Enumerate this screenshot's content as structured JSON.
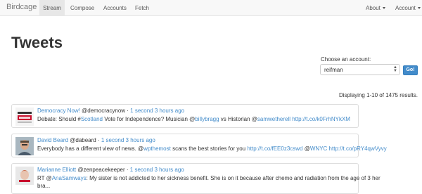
{
  "navbar": {
    "brand": "Birdcage",
    "items": [
      "Stream",
      "Compose",
      "Accounts",
      "Fetch"
    ],
    "right_items": [
      "About",
      "Account"
    ]
  },
  "page_title": "Tweets",
  "account_select": {
    "label": "Choose an account:",
    "value": "reifman",
    "button": "Go!"
  },
  "results_text": "Displaying 1-10 of 1475 results.",
  "tweets": [
    {
      "name": "Democracy Now!",
      "handle": "@democracynow",
      "sep": " · ",
      "time": "1 second 3 hours ago",
      "t1": "Debate: Should #",
      "l1": "Scotland",
      "t2": " Vote for Independence? Musician @",
      "l2": "billybragg",
      "t3": " vs Historian @",
      "l3": "samwetherell",
      "t4": " ",
      "l4": "http://t.co/k0FrhNYkXM"
    },
    {
      "name": "David Beard",
      "handle": "@dabeard",
      "sep": " · ",
      "time": "1 second 3 hours ago",
      "t1": "Everybody has a different view of news. @",
      "l1": "wpthemost",
      "t2": " scans the best stories for you ",
      "l2": "http://t.co/fEE0z3cswd",
      "t3": " @",
      "l3": "WNYC",
      "t4": " ",
      "l4": "http://t.co/pRY4qwVyvy"
    },
    {
      "name": "Marianne Elliott",
      "handle": "@zenpeacekeeper",
      "sep": " · ",
      "time": "1 second 3 hours ago",
      "t1": "RT @",
      "l1": "AnaSamways",
      "t2": ": My sister is not addicted to her sickness benefit. She is on it because after chemo and radiation from the age of 3 her",
      "t3": "bra..."
    }
  ]
}
